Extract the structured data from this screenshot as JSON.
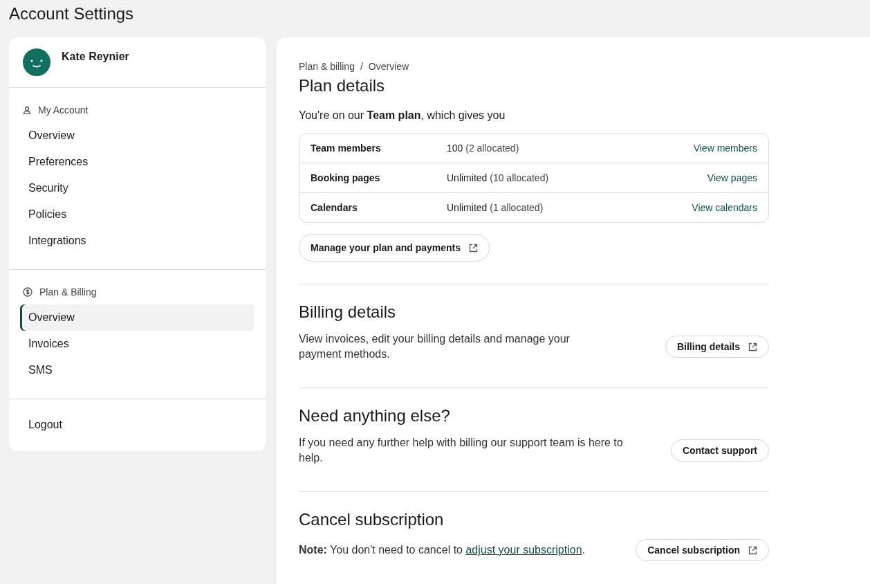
{
  "page_title": "Account Settings",
  "sidebar": {
    "user": {
      "name": "Kate Reynier"
    },
    "groups": [
      {
        "title": "My Account",
        "items": [
          {
            "label": "Overview",
            "selected": false
          },
          {
            "label": "Preferences",
            "selected": false
          },
          {
            "label": "Security",
            "selected": false
          },
          {
            "label": "Policies",
            "selected": false
          },
          {
            "label": "Integrations",
            "selected": false
          }
        ]
      },
      {
        "title": "Plan & Billing",
        "items": [
          {
            "label": "Overview",
            "selected": true
          },
          {
            "label": "Invoices",
            "selected": false
          },
          {
            "label": "SMS",
            "selected": false
          }
        ]
      }
    ],
    "logout": "Logout"
  },
  "main": {
    "breadcrumb": [
      "Plan & billing",
      "Overview"
    ],
    "breadcrumb_separator": "/",
    "plan": {
      "title": "Plan details",
      "intro": "You're on our **Team plan**, which gives you",
      "rows": [
        {
          "label": "Team members",
          "value": "100",
          "detail": "(2 allocated)",
          "link": "View members"
        },
        {
          "label": "Booking pages",
          "value": "Unlimited",
          "detail": "(10 allocated)",
          "link": "View pages"
        },
        {
          "label": "Calendars",
          "value": "Unlimited",
          "detail": "(1 allocated)",
          "link": "View calendars"
        }
      ],
      "button": {
        "label": "Manage your plan and payments",
        "external": true
      }
    },
    "sections": [
      {
        "title": "Billing details",
        "text": "View invoices, edit your billing details and manage your payment methods.",
        "button": {
          "label": "Billing details",
          "external": true
        }
      },
      {
        "title": "Need anything else?",
        "text": "If you need any further help with billing our support team is here to help.",
        "button": {
          "label": "Contact support",
          "external": false
        }
      },
      {
        "title": "Cancel subscription",
        "note": {
          "text": "**Note:** You don't need to cancel to ",
          "link": "adjust your subscription",
          "after": "."
        },
        "button": {
          "label": "Cancel subscription",
          "external": true
        }
      }
    ]
  }
}
